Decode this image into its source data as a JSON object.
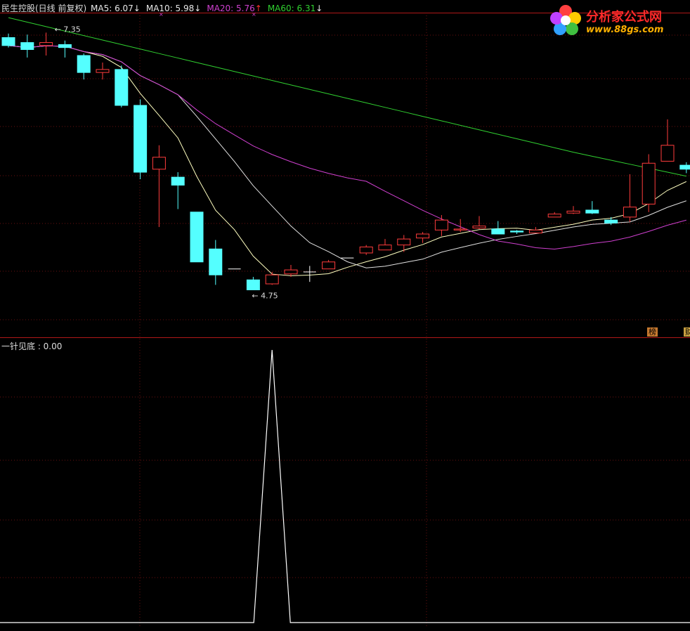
{
  "header": {
    "stock_title": "民生控股(日线 前复权)",
    "ma": [
      {
        "label": "MA5: 6.07",
        "arrow": "↓",
        "color": "#e8e8e8",
        "arrow_color": "#e8e8e8"
      },
      {
        "label": "MA10: 5.98",
        "arrow": "↓",
        "color": "#e8e8e8",
        "arrow_color": "#e8e8e8"
      },
      {
        "label": "MA20: 5.76",
        "arrow": "↑",
        "color": "#d040d0",
        "arrow_color": "#ff3030"
      },
      {
        "label": "MA60: 6.31",
        "arrow": "↓",
        "color": "#30d030",
        "arrow_color": "#e8e8e8"
      }
    ]
  },
  "indicator": {
    "label": "一针见底 : 0.00"
  },
  "logo": {
    "line1": "分析家公式网",
    "line2": "www.88gs.com"
  },
  "tags": {
    "left": "榜",
    "right": "财"
  },
  "chart_data": {
    "type": "candlestick",
    "price_range": [
      4.4,
      7.55
    ],
    "annotations": {
      "high": "7.35",
      "low": "4.75"
    },
    "candles": [
      [
        7.3,
        7.22,
        7.34,
        7.2
      ],
      [
        7.25,
        7.18,
        7.33,
        7.1
      ],
      [
        7.22,
        7.25,
        7.35,
        7.12
      ],
      [
        7.23,
        7.2,
        7.27,
        7.1
      ],
      [
        7.12,
        6.95,
        7.14,
        6.88
      ],
      [
        6.95,
        6.98,
        7.05,
        6.88
      ],
      [
        6.98,
        6.62,
        7.02,
        6.6
      ],
      [
        6.62,
        5.95,
        6.68,
        5.88
      ],
      [
        5.98,
        6.1,
        6.22,
        5.4
      ],
      [
        5.9,
        5.82,
        5.95,
        5.58
      ],
      [
        5.55,
        5.05,
        5.55,
        5.05
      ],
      [
        5.18,
        4.92,
        5.27,
        4.82
      ],
      [
        4.98,
        4.98,
        4.98,
        4.98
      ],
      [
        4.87,
        4.77,
        4.9,
        4.77
      ],
      [
        4.83,
        4.92,
        4.95,
        4.82
      ],
      [
        4.93,
        4.97,
        5.02,
        4.9
      ],
      [
        4.95,
        4.95,
        5.01,
        4.85
      ],
      [
        4.98,
        5.05,
        5.07,
        4.98
      ],
      [
        5.09,
        5.09,
        5.09,
        5.09
      ],
      [
        5.14,
        5.2,
        5.22,
        5.12
      ],
      [
        5.17,
        5.22,
        5.28,
        5.17
      ],
      [
        5.22,
        5.28,
        5.32,
        5.15
      ],
      [
        5.29,
        5.33,
        5.35,
        5.24
      ],
      [
        5.37,
        5.47,
        5.52,
        5.31
      ],
      [
        5.37,
        5.38,
        5.48,
        5.35
      ],
      [
        5.39,
        5.41,
        5.51,
        5.38
      ],
      [
        5.38,
        5.33,
        5.46,
        5.33
      ],
      [
        5.36,
        5.35,
        5.37,
        5.33
      ],
      [
        5.34,
        5.37,
        5.4,
        5.34
      ],
      [
        5.5,
        5.53,
        5.55,
        5.5
      ],
      [
        5.54,
        5.56,
        5.61,
        5.53
      ],
      [
        5.57,
        5.54,
        5.66,
        5.53
      ],
      [
        5.47,
        5.44,
        5.5,
        5.42
      ],
      [
        5.5,
        5.6,
        5.93,
        5.45
      ],
      [
        5.63,
        6.04,
        6.13,
        5.55
      ],
      [
        6.06,
        6.22,
        6.48,
        6.06
      ],
      [
        6.02,
        5.98,
        6.05,
        5.94
      ]
    ],
    "ma5_color": "#ffffc0",
    "ma10_color": "#e0e0e0",
    "ma20_color": "#d040d0",
    "ma60_color": "#30d030",
    "up_color": "#ff3c3c",
    "down_color": "#54ffff",
    "indicator_signal": {
      "type": "line",
      "value_range": [
        0,
        1
      ],
      "spike_index": 14,
      "values_nonzero": "spike only at one bar"
    }
  }
}
